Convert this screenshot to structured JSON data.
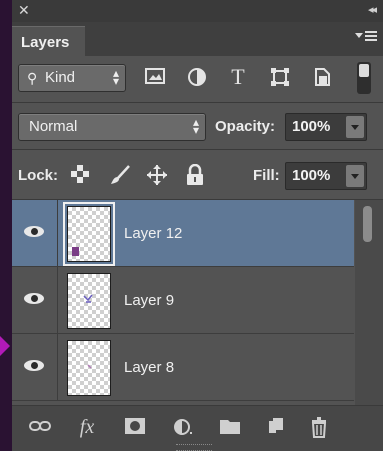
{
  "window": {
    "close_glyph": "✕",
    "collapse_glyph": "◂◂"
  },
  "panel": {
    "tab_label": "Layers",
    "menu_icon": "panel-menu-icon"
  },
  "filter": {
    "kind_label": "Kind",
    "icons": [
      "pixel-filter-icon",
      "adjustment-filter-icon",
      "type-filter-icon",
      "shape-filter-icon",
      "smart-object-filter-icon"
    ],
    "type_glyph": "T"
  },
  "blend": {
    "mode": "Normal",
    "opacity_label": "Opacity:",
    "opacity_value": "100%"
  },
  "lock": {
    "label": "Lock:",
    "icons": [
      "lock-transparent-icon",
      "lock-image-icon",
      "lock-position-icon",
      "lock-all-icon"
    ],
    "fill_label": "Fill:",
    "fill_value": "100%"
  },
  "layers": [
    {
      "name": "Layer 12",
      "selected": true,
      "visible": true
    },
    {
      "name": "Layer 9",
      "selected": false,
      "visible": true
    },
    {
      "name": "Layer 8",
      "selected": false,
      "visible": true
    }
  ],
  "footer": {
    "buttons": [
      "link-layers",
      "fx-effects",
      "add-mask",
      "adjustment-layer",
      "new-group",
      "new-layer",
      "delete-layer"
    ],
    "fx_label": "fx"
  },
  "colors": {
    "panel_bg": "#535353",
    "selection": "#5f7896",
    "accent_purple": "#b21ab8"
  }
}
